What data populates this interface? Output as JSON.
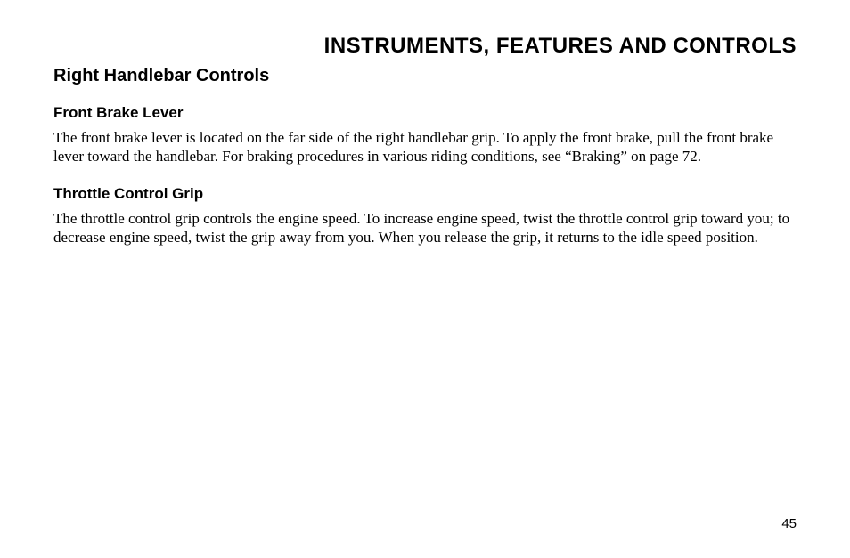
{
  "pageTitle": "INSTRUMENTS, FEATURES AND CONTROLS",
  "sectionHeading": "Right Handlebar Controls",
  "subsections": [
    {
      "heading": "Front Brake Lever",
      "body": "The front brake lever is located on the far side of the right handlebar grip.  To apply the front brake, pull the front brake lever toward the handlebar. For braking procedures in various riding conditions, see “Braking” on page 72."
    },
    {
      "heading": "Throttle Control Grip",
      "body": "The throttle control grip controls the engine speed. To increase engine speed, twist the throttle control grip toward you; to decrease engine speed, twist the grip away from you. When you release the grip, it returns to the idle speed position."
    }
  ],
  "pageNumber": "45"
}
